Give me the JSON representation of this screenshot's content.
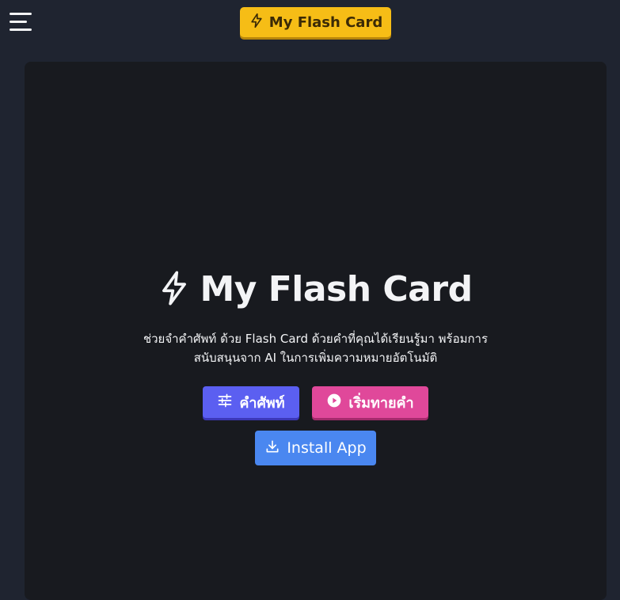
{
  "header": {
    "menu_icon": "hamburger-menu-icon",
    "brand_label": "My Flash Card",
    "brand_icon": "lightning-icon",
    "brand_color": "#f6bd16"
  },
  "hero": {
    "title": "My Flash Card",
    "title_icon": "lightning-icon",
    "description_line1": "ช่วยจำคำศัพท์ ด้วย Flash Card ด้วยคำที่คุณได้เรียนรู้มา พร้อมการ",
    "description_line2": "สนับสนุนจาก AI ในการเพิ่มความหมายอัตโนมัติ"
  },
  "actions": {
    "vocab_label": "คำศัพท์",
    "vocab_icon": "sliders-icon",
    "vocab_color": "#5b5ff1",
    "play_label": "เริ่มทายคำ",
    "play_icon": "play-circle-icon",
    "play_color": "#e0489a",
    "install_label": "Install App",
    "install_icon": "download-icon",
    "install_color": "#4a87f0"
  },
  "colors": {
    "background": "#1f2430",
    "panel": "#181a1f"
  }
}
